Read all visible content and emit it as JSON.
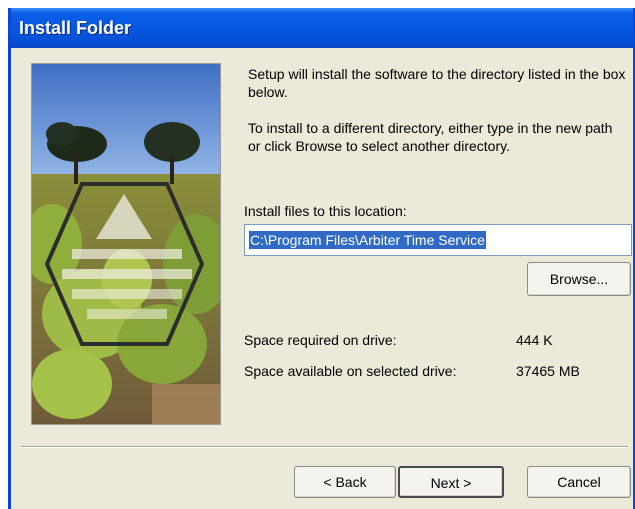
{
  "window": {
    "title": "Install Folder"
  },
  "intro": {
    "line1": "Setup will install the software to the directory listed in the box below.",
    "line2": "To install to a different directory, either type in the new path or click Browse to select another directory."
  },
  "location": {
    "label": "Install files to this location:",
    "path": "C:\\Program Files\\Arbiter Time Service",
    "browse_label": "Browse..."
  },
  "space": {
    "required_label": "Space required on drive:",
    "required_value": "444 K",
    "available_label": "Space available on selected drive:",
    "available_value": "37465 MB"
  },
  "buttons": {
    "back_label": "< Back",
    "next_label": "Next >",
    "cancel_label": "Cancel"
  },
  "colors": {
    "titlebar": "#0758e0",
    "dialog_bg": "#ece9d8",
    "selection": "#316ac5"
  }
}
